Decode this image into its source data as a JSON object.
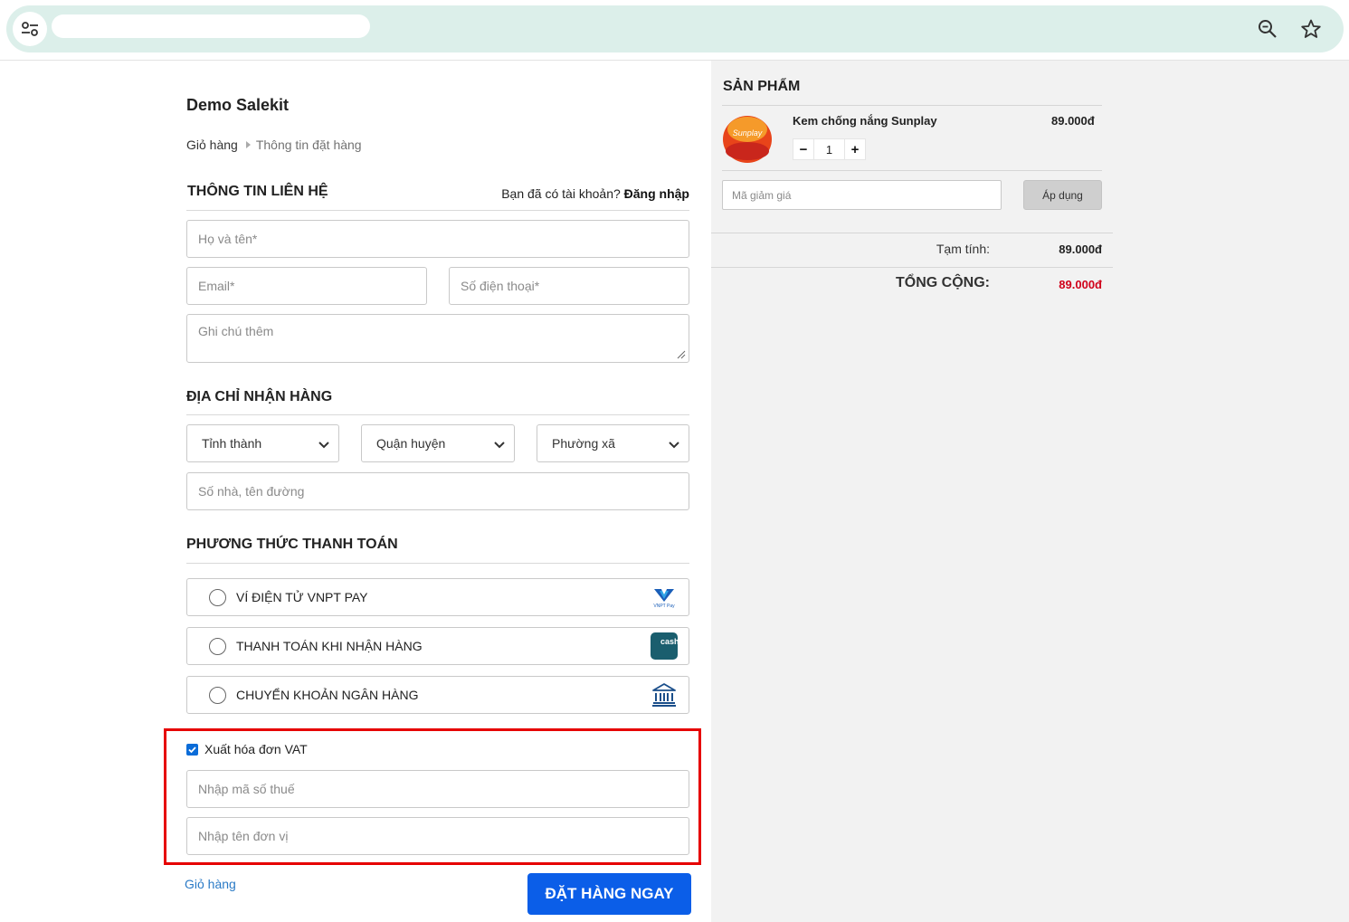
{
  "browser": {
    "left_icon": "site-settings-icon",
    "right_icons": [
      "zoom-icon",
      "bookmark-star-icon"
    ]
  },
  "shop": {
    "title": "Demo Salekit"
  },
  "breadcrumb": {
    "cart": "Giỏ hàng",
    "current": "Thông tin đặt hàng"
  },
  "contact": {
    "title": "THÔNG TIN LIÊN HỆ",
    "login_prompt": "Bạn đã có tài khoản?",
    "login_link": "Đăng nhập",
    "name_placeholder": "Họ và tên*",
    "email_placeholder": "Email*",
    "phone_placeholder": "Số điện thoại*",
    "note_placeholder": "Ghi chú thêm"
  },
  "address": {
    "title": "ĐỊA CHỈ NHẬN HÀNG",
    "province": "Tỉnh thành",
    "district": "Quận huyện",
    "ward": "Phường xã",
    "street_placeholder": "Số nhà, tên đường"
  },
  "payment": {
    "title": "PHƯƠNG THỨC THANH TOÁN",
    "options": [
      {
        "label": "VÍ ĐIỆN TỬ VNPT PAY",
        "icon": "vnpt-pay-logo",
        "logo_text": "VNPT Pay"
      },
      {
        "label": "THANH TOÁN KHI NHẬN HÀNG",
        "icon": "cash-on-delivery-icon",
        "logo_text": "cash deli"
      },
      {
        "label": "CHUYỂN KHOẢN NGÂN HÀNG",
        "icon": "bank-icon"
      }
    ]
  },
  "vat": {
    "label": "Xuất hóa đơn VAT",
    "checked": true,
    "tax_placeholder": "Nhập mã số thuế",
    "company_placeholder": "Nhập tên đơn vị"
  },
  "footer": {
    "back_link": "Giỏ hàng",
    "order_button": "ĐẶT HÀNG NGAY"
  },
  "cart": {
    "title": "SẢN PHẨM",
    "product": {
      "name": "Kem chống nắng Sunplay",
      "price": "89.000đ",
      "quantity": "1",
      "minus": "−",
      "plus": "+",
      "image_text": "Sunplay"
    },
    "coupon_placeholder": "Mã giảm giá",
    "apply_button": "Áp dụng",
    "subtotal_label": "Tạm tính:",
    "subtotal_value": "89.000đ",
    "total_label": "TỔNG CỘNG:",
    "total_value": "89.000đ",
    "total_color": "#d0021b"
  },
  "colors": {
    "primary_button": "#0b5ee8",
    "highlight_border": "#e60000",
    "omnibox": "#dcefea"
  }
}
